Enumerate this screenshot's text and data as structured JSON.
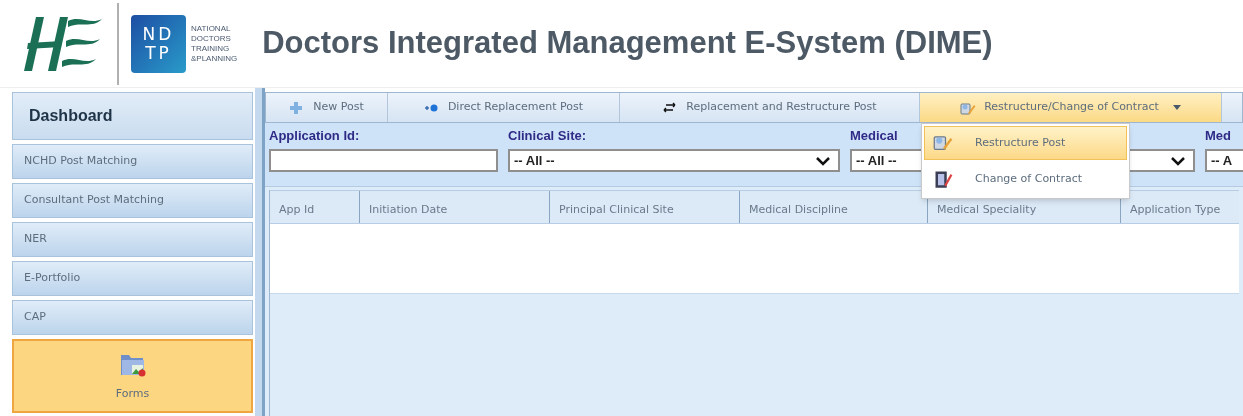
{
  "header": {
    "ndtp_logo": {
      "letters_top": "ND",
      "letters_bottom": "TP",
      "lines": [
        "NATIONAL",
        "DOCTORS",
        "TRAINING",
        "&PLANNING"
      ]
    },
    "title": "Doctors Integrated Management E-System (DIME)"
  },
  "sidebar": {
    "title": "Dashboard",
    "items": [
      {
        "label": "NCHD Post Matching",
        "kind": "bar",
        "selected": false
      },
      {
        "label": "Consultant Post Matching",
        "kind": "bar",
        "selected": false
      },
      {
        "label": "NER",
        "kind": "bar",
        "selected": false
      },
      {
        "label": "E-Portfolio",
        "kind": "bar",
        "selected": false
      },
      {
        "label": "CAP",
        "kind": "bar",
        "selected": false
      },
      {
        "label": "Forms",
        "kind": "tile",
        "selected": true
      }
    ]
  },
  "toolbar": [
    {
      "label": "New Post",
      "kind": "button"
    },
    {
      "label": "Direct Replacement Post",
      "kind": "button"
    },
    {
      "label": "Replacement and Restructure Post",
      "kind": "button"
    },
    {
      "label": "Restructure/Change of Contract",
      "kind": "dropdown",
      "expanded": true,
      "menu": [
        {
          "label": "Restructure Post",
          "selected": true
        },
        {
          "label": "Change of Contract",
          "selected": false
        }
      ]
    }
  ],
  "filters": [
    {
      "label": "Application Id:",
      "kind": "text"
    },
    {
      "label": "Clinical Site:",
      "kind": "select",
      "value": "-- All --"
    },
    {
      "label": "Medical",
      "kind": "select",
      "value": "-- All --"
    },
    {
      "label": "Med",
      "kind": "select",
      "value": "-- A"
    }
  ],
  "table": {
    "columns": [
      "App Id",
      "Initiation Date",
      "Principal Clinical Site",
      "Medical Discipline",
      "Medical Speciality",
      "Application Type"
    ]
  }
}
